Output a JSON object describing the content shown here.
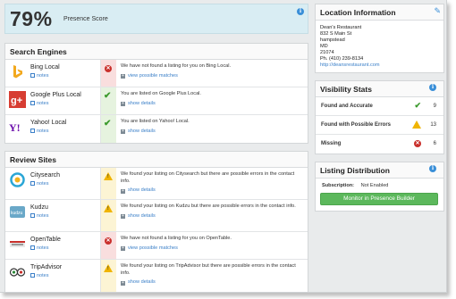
{
  "presence": {
    "percent": "79%",
    "label": "Presence Score",
    "value": 79
  },
  "search_engines": {
    "title": "Search Engines",
    "rows": [
      {
        "name": "Bing Local",
        "notes": "notes",
        "status": "error",
        "message": "We have not found a listing for you on Bing Local.",
        "link": "view possible matches"
      },
      {
        "name": "Google Plus Local",
        "notes": "notes",
        "status": "ok",
        "message": "You are listed on Google Plus Local.",
        "link": "show details"
      },
      {
        "name": "Yahoo! Local",
        "notes": "notes",
        "status": "ok",
        "message": "You are listed on Yahoo! Local.",
        "link": "show details"
      }
    ]
  },
  "review_sites": {
    "title": "Review Sites",
    "rows": [
      {
        "name": "Citysearch",
        "notes": "notes",
        "status": "warning",
        "message": "We found your listing on Citysearch but there are possible errors in the contact info.",
        "link": "show details"
      },
      {
        "name": "Kudzu",
        "notes": "notes",
        "status": "warning",
        "message": "We found your listing on Kudzu but there are possible errors in the contact info.",
        "link": "show details"
      },
      {
        "name": "OpenTable",
        "notes": "notes",
        "status": "error",
        "message": "We have not found a listing for you on OpenTable.",
        "link": "view possible matches"
      },
      {
        "name": "TripAdvisor",
        "notes": "notes",
        "status": "warning",
        "message": "We found your listing on TripAdvisor but there are possible errors in the contact info.",
        "link": "show details"
      }
    ]
  },
  "location": {
    "title": "Location Information",
    "name": "Dean's Restaurant",
    "street": "832 S Main St",
    "city": "hampstead",
    "state": "MD",
    "zip": "21074",
    "phone": "Ph. (410) 239-8134",
    "url": "http://deansrestaurant.com"
  },
  "visibility": {
    "title": "Visibility Stats",
    "rows": [
      {
        "label": "Found and Accurate",
        "status": "ok",
        "count": "9"
      },
      {
        "label": "Found with Possible Errors",
        "status": "warning",
        "count": "13"
      },
      {
        "label": "Missing",
        "status": "error",
        "count": "6"
      }
    ]
  },
  "distribution": {
    "title": "Listing Distribution",
    "subscription_label": "Subscription:",
    "subscription_value": "Not Enabled",
    "button": "Monitor in Presence Builder"
  },
  "colors": {
    "accent_blue": "#3a8fd8",
    "success": "#3c9a2e",
    "error": "#c9302c",
    "warning": "#f0b400",
    "button_green": "#5cb85c",
    "presence_bg": "#d9edf3"
  },
  "icons": [
    "info-icon",
    "edit-pencil-icon",
    "error-x-icon",
    "checkmark-icon",
    "warning-triangle-icon",
    "notes-icon",
    "plus-expand-icon"
  ]
}
